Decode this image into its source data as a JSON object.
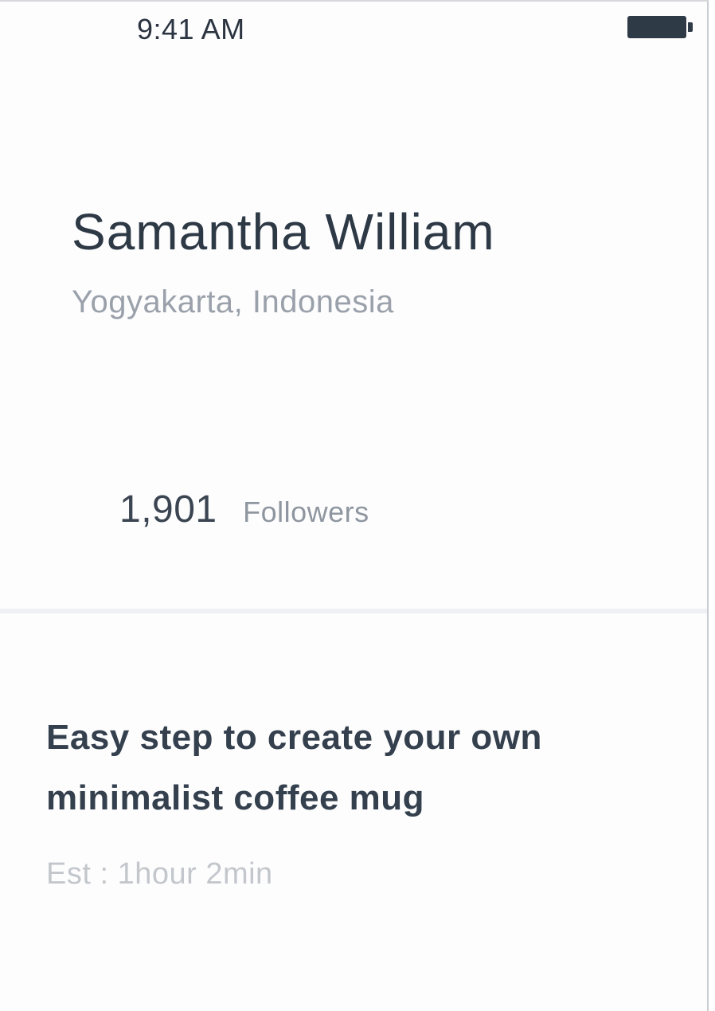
{
  "status_bar": {
    "time": "9:41 AM",
    "battery_icon": "battery-full-icon"
  },
  "profile": {
    "name": "Samantha William",
    "location": "Yogyakarta, Indonesia",
    "followers_count": "1,901",
    "followers_label": "Followers"
  },
  "post": {
    "title": "Easy step to create your own minimalist coffee mug",
    "estimate": "Est : 1hour 2min"
  },
  "colors": {
    "primary_text": "#2e3946",
    "secondary_text": "#9aa1aa",
    "muted_text": "#c3c7cc",
    "divider": "#eef0f3"
  }
}
